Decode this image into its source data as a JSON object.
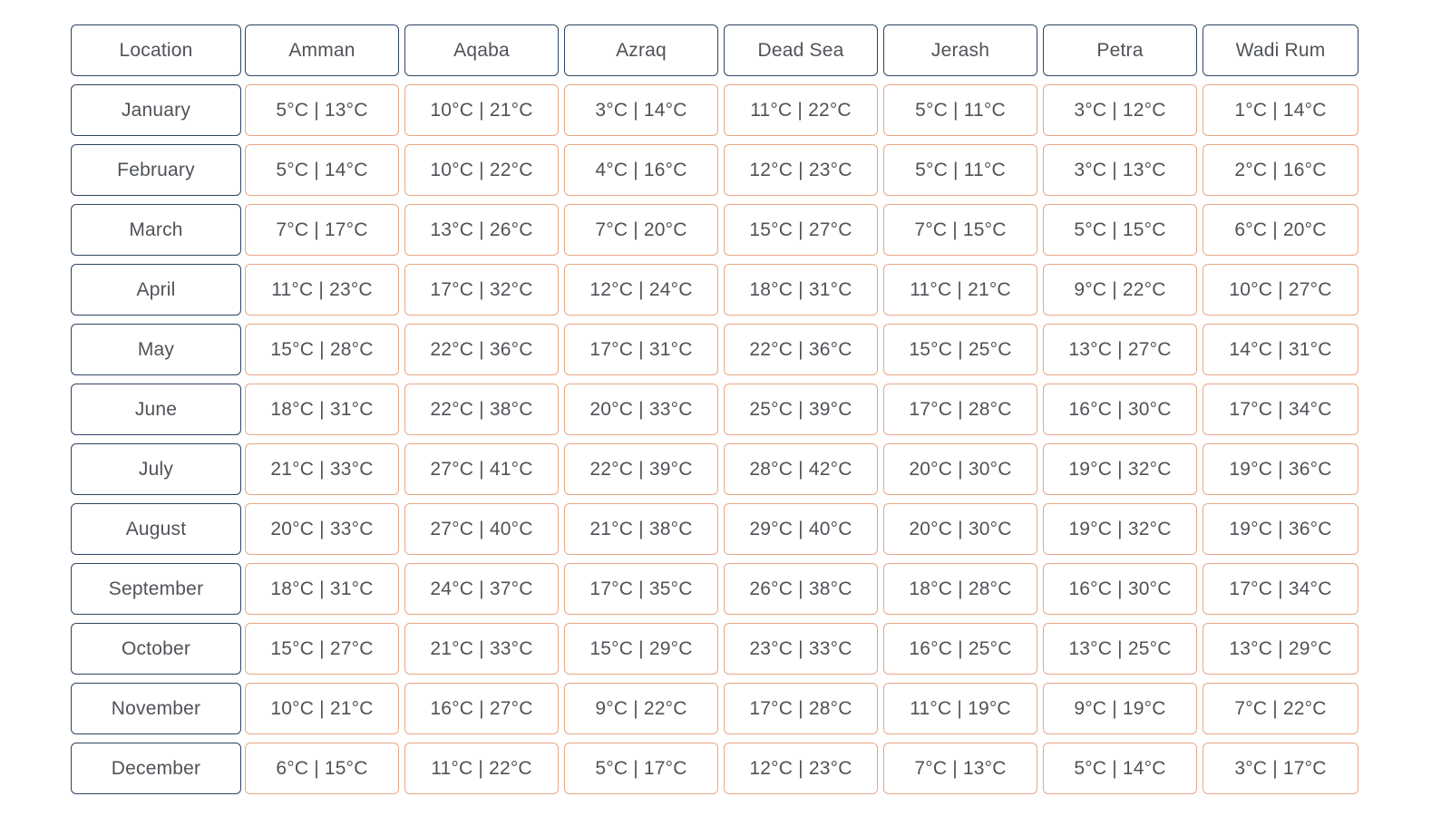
{
  "chart_data": {
    "type": "table",
    "columns": [
      "Location",
      "Amman",
      "Aqaba",
      "Azraq",
      "Dead Sea",
      "Jerash",
      "Petra",
      "Wadi Rum"
    ],
    "rows": [
      {
        "label": "January",
        "values": [
          "5°C | 13°C",
          "10°C | 21°C",
          "3°C | 14°C",
          "11°C | 22°C",
          "5°C | 11°C",
          "3°C | 12°C",
          "1°C | 14°C"
        ]
      },
      {
        "label": "February",
        "values": [
          "5°C | 14°C",
          "10°C | 22°C",
          "4°C | 16°C",
          "12°C | 23°C",
          "5°C | 11°C",
          "3°C | 13°C",
          "2°C | 16°C"
        ]
      },
      {
        "label": "March",
        "values": [
          "7°C | 17°C",
          "13°C | 26°C",
          "7°C | 20°C",
          "15°C | 27°C",
          "7°C | 15°C",
          "5°C | 15°C",
          "6°C | 20°C"
        ]
      },
      {
        "label": "April",
        "values": [
          "11°C | 23°C",
          "17°C | 32°C",
          "12°C | 24°C",
          "18°C | 31°C",
          "11°C | 21°C",
          "9°C | 22°C",
          "10°C | 27°C"
        ]
      },
      {
        "label": "May",
        "values": [
          "15°C | 28°C",
          "22°C | 36°C",
          "17°C | 31°C",
          "22°C | 36°C",
          "15°C | 25°C",
          "13°C | 27°C",
          "14°C | 31°C"
        ]
      },
      {
        "label": "June",
        "values": [
          "18°C | 31°C",
          "22°C | 38°C",
          "20°C | 33°C",
          "25°C | 39°C",
          "17°C | 28°C",
          "16°C | 30°C",
          "17°C | 34°C"
        ]
      },
      {
        "label": "July",
        "values": [
          "21°C | 33°C",
          "27°C | 41°C",
          "22°C | 39°C",
          "28°C | 42°C",
          "20°C | 30°C",
          "19°C | 32°C",
          "19°C | 36°C"
        ]
      },
      {
        "label": "August",
        "values": [
          "20°C | 33°C",
          "27°C | 40°C",
          "21°C | 38°C",
          "29°C | 40°C",
          "20°C | 30°C",
          "19°C | 32°C",
          "19°C | 36°C"
        ]
      },
      {
        "label": "September",
        "values": [
          "18°C | 31°C",
          "24°C | 37°C",
          "17°C | 35°C",
          "26°C | 38°C",
          "18°C | 28°C",
          "16°C | 30°C",
          "17°C | 34°C"
        ]
      },
      {
        "label": "October",
        "values": [
          "15°C | 27°C",
          "21°C | 33°C",
          "15°C | 29°C",
          "23°C | 33°C",
          "16°C | 25°C",
          "13°C | 25°C",
          "13°C | 29°C"
        ]
      },
      {
        "label": "November",
        "values": [
          "10°C | 21°C",
          "16°C | 27°C",
          "9°C | 22°C",
          "17°C | 28°C",
          "11°C | 19°C",
          "9°C | 19°C",
          "7°C | 22°C"
        ]
      },
      {
        "label": "December",
        "values": [
          "6°C | 15°C",
          "11°C | 22°C",
          "5°C | 17°C",
          "12°C | 23°C",
          "7°C | 13°C",
          "5°C | 14°C",
          "3°C | 17°C"
        ]
      }
    ],
    "colors": {
      "header_border": "#2f4463",
      "cell_border": "#e9a785",
      "text": "#4f5358"
    }
  }
}
